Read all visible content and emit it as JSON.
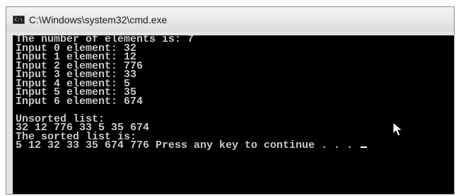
{
  "window": {
    "title": "C:\\Windows\\system32\\cmd.exe",
    "icon": "cmd-icon",
    "icon_text": "C:\\"
  },
  "console": {
    "lines": [
      "The number of elements is: 7",
      "Input 0 element: 32",
      "Input 1 element: 12",
      "Input 2 element: 776",
      "Input 3 element: 33",
      "Input 4 element: 5",
      "Input 5 element: 35",
      "Input 6 element: 674",
      "",
      "Unsorted list:",
      "32 12 776 33 5 35 674",
      "The sorted list is:",
      "5 12 32 33 35 674 776 Press any key to continue . . . "
    ],
    "background": "#000000",
    "foreground": "#c8c8c8"
  },
  "pointer": {
    "icon": "mouse-pointer-icon"
  }
}
